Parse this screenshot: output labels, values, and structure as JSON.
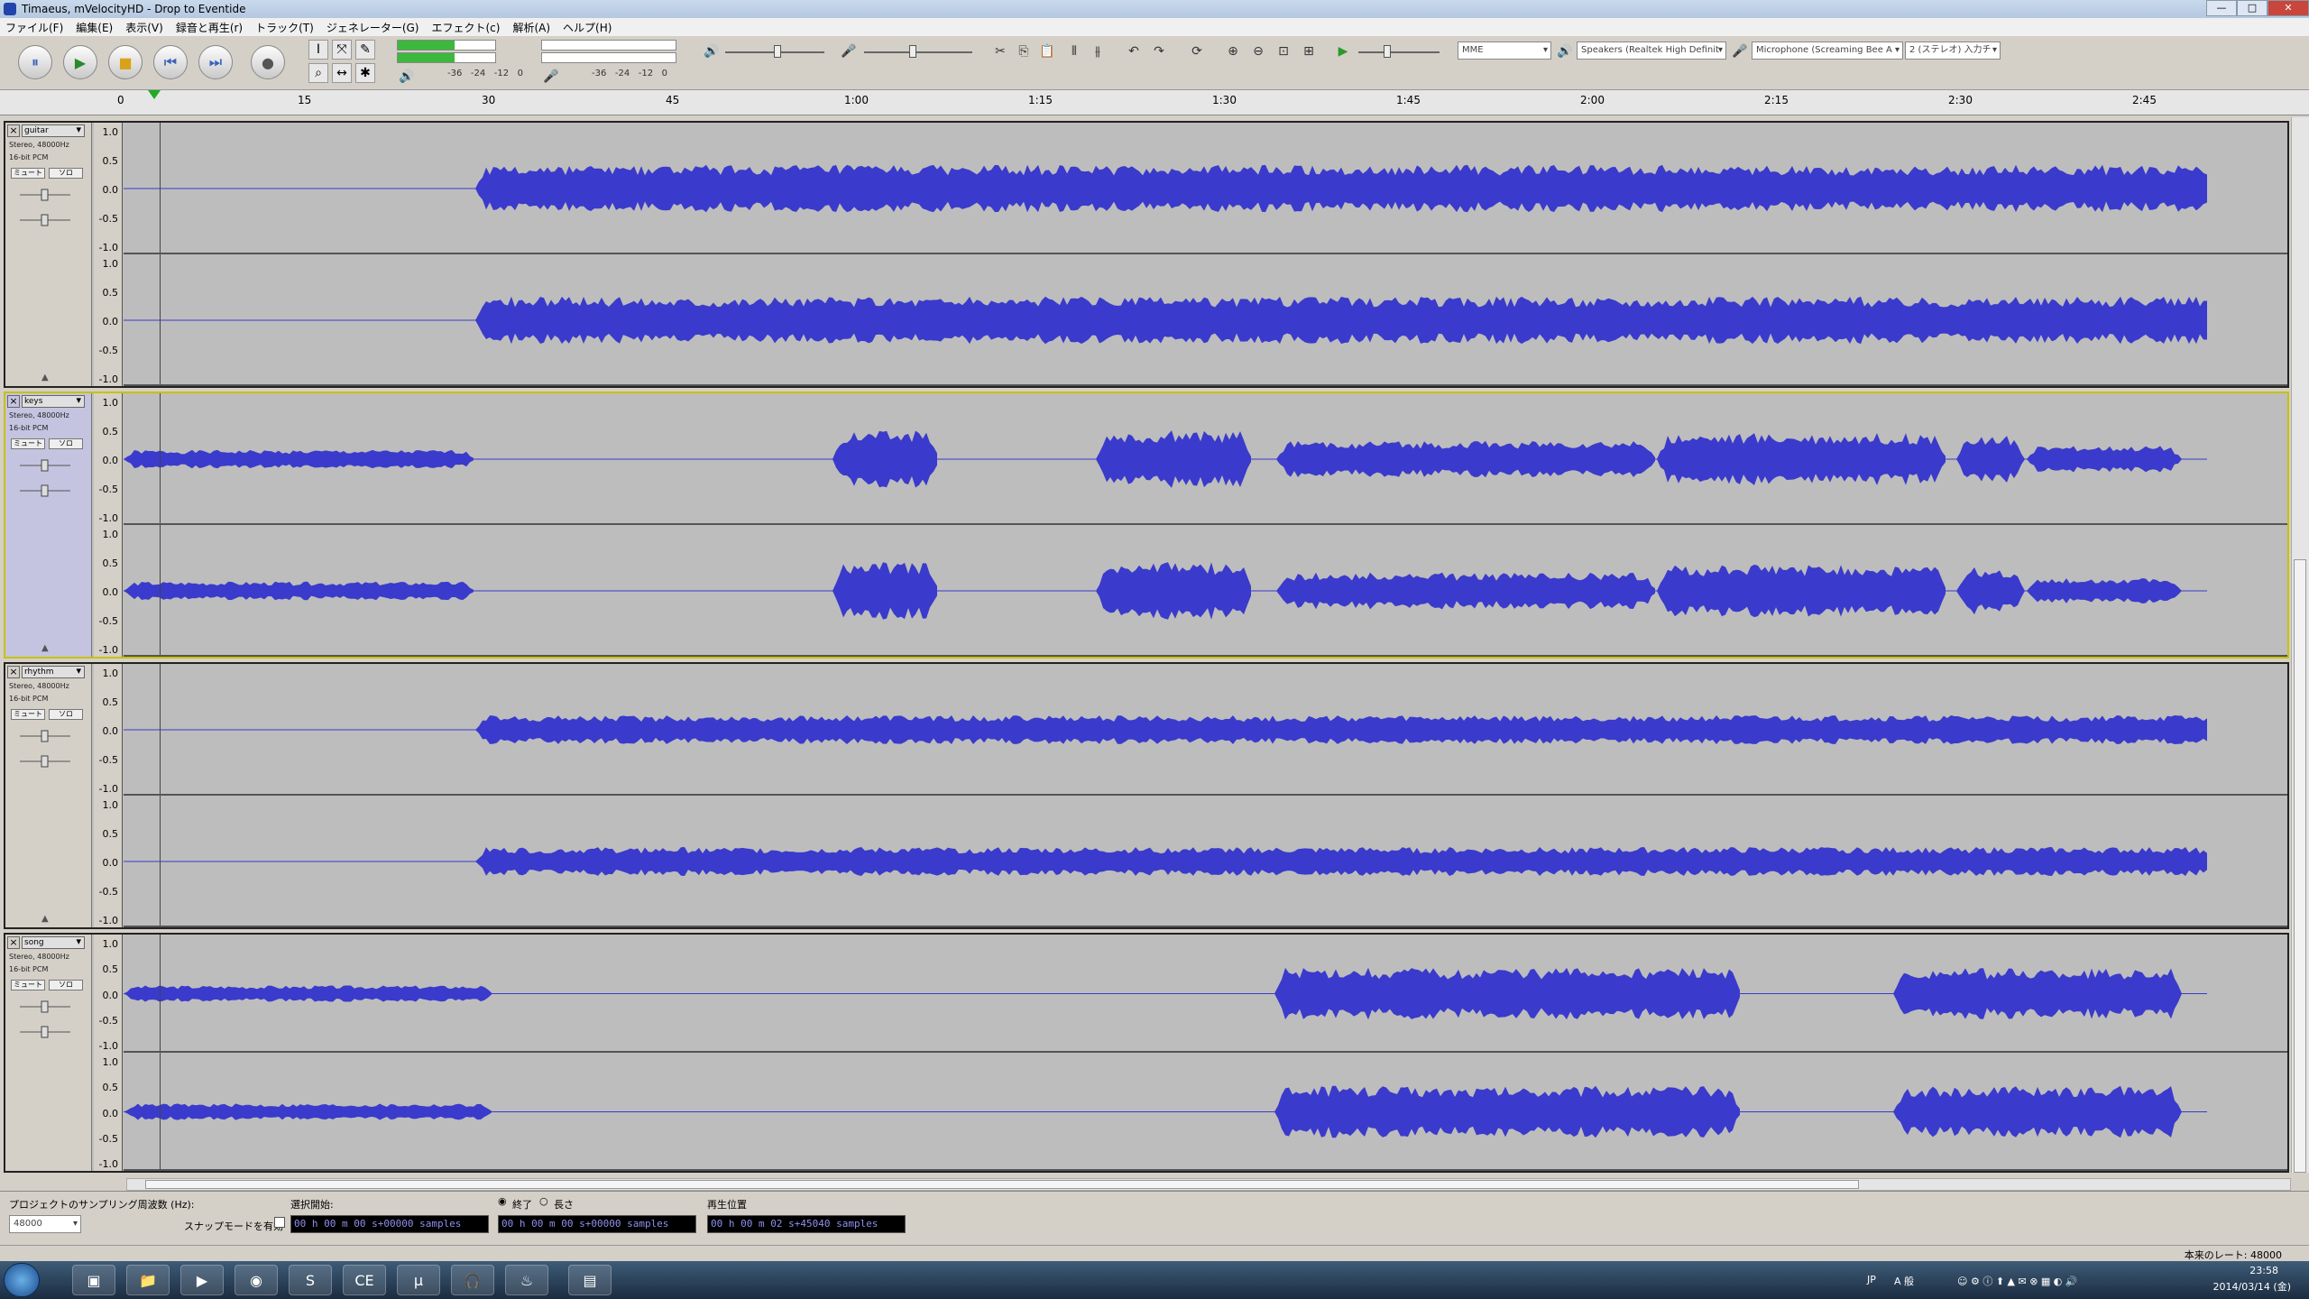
{
  "window": {
    "title": "Timaeus, mVelocityHD - Drop to Eventide",
    "controls": [
      "—",
      "□",
      "✕"
    ]
  },
  "menu": [
    "ファイル(F)",
    "編集(E)",
    "表示(V)",
    "録音と再生(r)",
    "トラック(T)",
    "ジェネレーター(G)",
    "エフェクト(c)",
    "解析(A)",
    "ヘルプ(H)"
  ],
  "transport": {
    "pause": "⏸",
    "play": "▶",
    "stop": "■",
    "skip_start": "⏮",
    "skip_end": "⏭",
    "record": "●"
  },
  "tools": {
    "select": "I",
    "envelope": "⤧",
    "draw": "✎",
    "zoom": "⌕",
    "timeshift": "↔",
    "multi": "✱"
  },
  "meters": {
    "rec_scale": "-36   -24   -12   0",
    "play_scale": "-36   -24   -12   0",
    "play_level": 0.58,
    "rec_level": 0.0
  },
  "devices": {
    "host": "MME",
    "speakers": "Speakers (Realtek High Definit",
    "microphone": "Microphone (Screaming Bee A",
    "channels": "2 (ステレオ) 入力チ"
  },
  "ruler": {
    "ticks": [
      "0",
      "15",
      "30",
      "45",
      "1:00",
      "1:15",
      "1:30",
      "1:45",
      "2:00",
      "2:15",
      "2:30",
      "2:45"
    ]
  },
  "tracks": [
    {
      "name": "guitar",
      "info1": "Stereo, 48000Hz",
      "info2": "16-bit PCM",
      "mute": "ミュート",
      "solo": "ソロ",
      "selected": false
    },
    {
      "name": "keys",
      "info1": "Stereo, 48000Hz",
      "info2": "16-bit PCM",
      "mute": "ミュート",
      "solo": "ソロ",
      "selected": true
    },
    {
      "name": "rhythm",
      "info1": "Stereo, 48000Hz",
      "info2": "16-bit PCM",
      "mute": "ミュート",
      "solo": "ソロ",
      "selected": false
    },
    {
      "name": "song",
      "info1": "Stereo, 48000Hz",
      "info2": "16-bit PCM",
      "mute": "ミュート",
      "solo": "ソロ",
      "selected": false
    }
  ],
  "amp_labels": [
    "1.0",
    "0.5",
    "0.0",
    "-0.5",
    "-1.0"
  ],
  "selection": {
    "rate_label": "プロジェクトのサンプリング周波数 (Hz):",
    "rate_value": "48000",
    "snap_label": "スナップモードを有効",
    "start_label": "選択開始:",
    "end_radio": "終了",
    "length_radio": "長さ",
    "start_time": "00 h 00 m 00 s+00000 samples",
    "end_time": "00 h 00 m 00 s+00000 samples",
    "play_pos_label": "再生位置",
    "play_pos": "00 h 00 m 02 s+45040 samples"
  },
  "status": {
    "actual_rate": "本来のレート: 48000"
  },
  "taskbar": {
    "time": "23:58",
    "date": "2014/03/14 (金)",
    "lang": "JP",
    "ime": "A 般"
  }
}
